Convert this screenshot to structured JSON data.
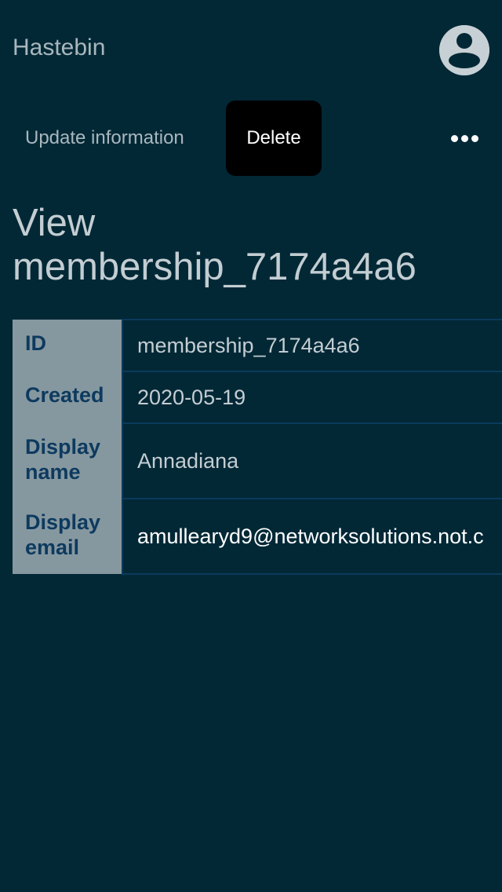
{
  "header": {
    "app_title": "Hastebin",
    "avatar_icon": "user-circle-icon"
  },
  "toolbar": {
    "update_label": "Update information",
    "delete_label": "Delete",
    "more_icon": "more-horizontal-icon"
  },
  "page": {
    "title": "View membership_7174a4a6"
  },
  "details": {
    "rows": [
      {
        "label": "ID",
        "value": "membership_7174a4a6"
      },
      {
        "label": "Created",
        "value": "2020-05-19"
      },
      {
        "label": "Display name",
        "value": "Annadiana"
      },
      {
        "label": "Display email",
        "value": "amullearyd9@networksolutions.not.c"
      }
    ]
  },
  "colors": {
    "background": "#022836",
    "label_bg": "#86989f",
    "label_text": "#0d3a5f",
    "delete_bg": "#000000"
  }
}
